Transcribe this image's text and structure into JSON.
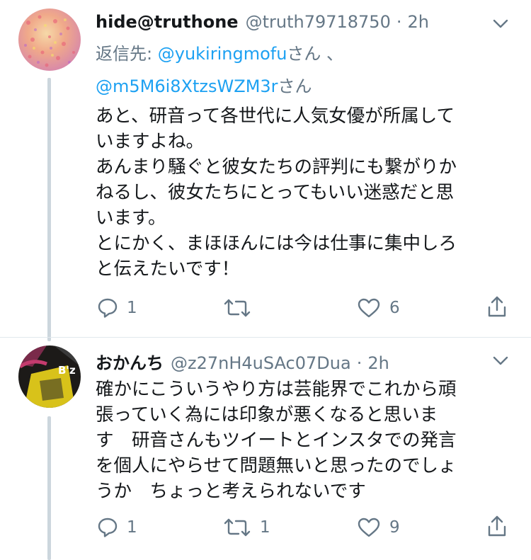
{
  "tweets": [
    {
      "name": "hide@truthone",
      "handle": "@truth79718750",
      "separator": "·",
      "time": "2h",
      "reply_prefix": "返信先:",
      "reply_users": [
        "@yukiringmofu",
        "@m5M6i8XtzsWZM3r"
      ],
      "reply_suffix1": "さん 、",
      "reply_suffix2": "さん",
      "text": "あと、研音って各世代に人気女優が所属して\nいますよね。\nあんまり騒ぐと彼女たちの評判にも繋がりか\nねるし、彼女たちにとってもいい迷惑だと思\nいます。\nとにかく、まほほんには今は仕事に集中しろ\nと伝えたいです！",
      "replies": "1",
      "retweets": "",
      "likes": "6"
    },
    {
      "name": "おかんち",
      "handle": "@z27nH4uSAc07Dua",
      "separator": "·",
      "time": "2h",
      "avatar_text": "B'z",
      "text": "確かにこういうやり方は芸能界でこれから頑\n張っていく為には印象が悪くなると思いま\nす　研音さんもツイートとインスタでの発言\nを個人にやらせて問題無いと思ったのでしょ\nうか　ちょっと考えられないです",
      "replies": "1",
      "retweets": "1",
      "likes": "9"
    }
  ],
  "colors": {
    "accent": "#1da1f2",
    "secondary": "#657786",
    "thread_line": "#ccd6dd"
  },
  "icons": [
    "reply-icon",
    "retweet-icon",
    "like-icon",
    "share-icon",
    "chevron-down-icon"
  ]
}
